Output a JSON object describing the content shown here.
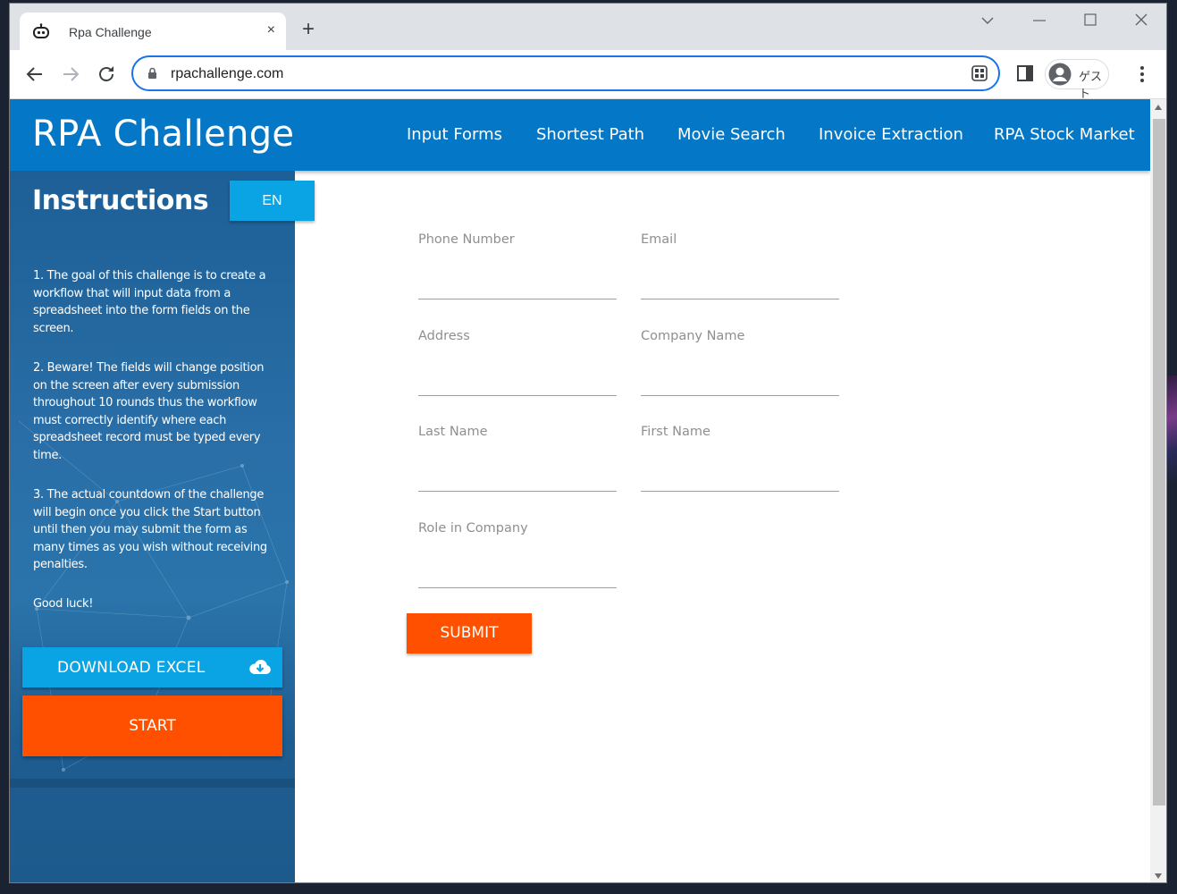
{
  "browser": {
    "tab_title": "Rpa Challenge",
    "tab_close": "×",
    "new_tab": "+",
    "url": "rpachallenge.com",
    "profile_label": "ゲスト"
  },
  "header": {
    "brand": "RPA Challenge",
    "nav": [
      "Input Forms",
      "Shortest Path",
      "Movie Search",
      "Invoice Extraction",
      "RPA Stock Market"
    ]
  },
  "sidebar": {
    "title": "Instructions",
    "lang_button": "EN",
    "paragraphs": [
      "1. The goal of this challenge is to create a workflow that will input data from a spreadsheet into the form fields on the screen.",
      "2. Beware! The fields will change position on the screen after every submission throughout 10 rounds thus the workflow must correctly identify where each spreadsheet record must be typed every time.",
      "3. The actual countdown of the challenge will begin once you click the Start button until then you may submit the form as many times as you wish without receiving penalties.",
      "Good luck!"
    ],
    "download_button": "DOWNLOAD EXCEL",
    "start_button": "START"
  },
  "form": {
    "fields": [
      {
        "label": "Phone Number",
        "value": ""
      },
      {
        "label": "Email",
        "value": ""
      },
      {
        "label": "Address",
        "value": ""
      },
      {
        "label": "Company Name",
        "value": ""
      },
      {
        "label": "Last Name",
        "value": ""
      },
      {
        "label": "First Name",
        "value": ""
      },
      {
        "label": "Role in Company",
        "value": ""
      }
    ],
    "submit_button": "SUBMIT"
  },
  "icons": {
    "tab_favicon": "robot-icon",
    "back": "arrow-left-icon",
    "forward": "arrow-right-icon",
    "reload": "reload-icon",
    "lock": "lock-icon",
    "qr": "qr-code-icon",
    "side_panel": "side-panel-icon",
    "profile": "account-circle-icon",
    "menu": "kebab-menu-icon",
    "download": "cloud-download-icon"
  },
  "colors": {
    "header_blue": "#0477c6",
    "accent_cyan": "#0aa3e3",
    "accent_orange": "#ff5000",
    "omnibox_focus": "#1a73e8"
  }
}
